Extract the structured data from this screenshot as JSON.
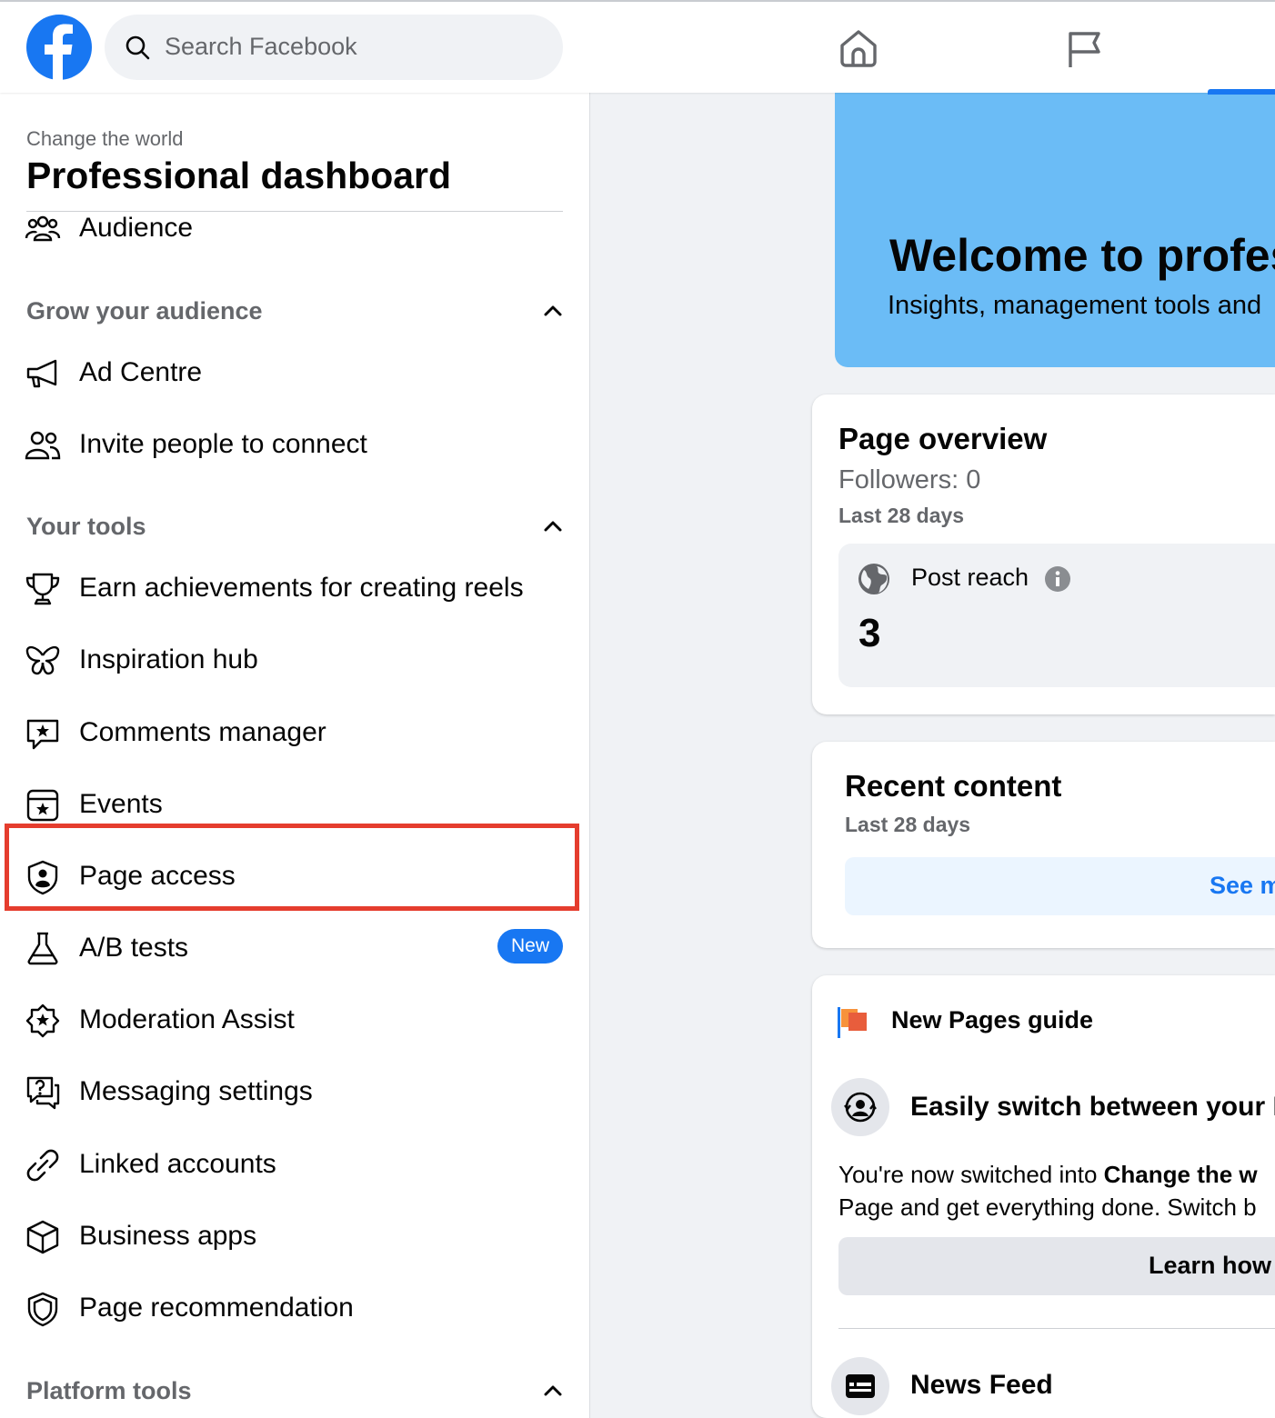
{
  "topbar": {
    "search_placeholder": "Search Facebook",
    "logo": "facebook-logo-icon",
    "nav_icons": [
      "home-icon",
      "flag-icon"
    ]
  },
  "sidebar": {
    "subtitle": "Change the world",
    "title": "Professional dashboard",
    "top_item": {
      "label": "Audience",
      "icon": "audience-icon"
    },
    "sections": [
      {
        "label": "Grow your audience",
        "items": [
          {
            "label": "Ad Centre",
            "icon": "megaphone-icon"
          },
          {
            "label": "Invite people to connect",
            "icon": "people-icon"
          }
        ]
      },
      {
        "label": "Your tools",
        "items": [
          {
            "label": "Earn achievements for creating reels",
            "icon": "trophy-icon"
          },
          {
            "label": "Inspiration hub",
            "icon": "butterfly-icon"
          },
          {
            "label": "Comments manager",
            "icon": "comment-star-icon"
          },
          {
            "label": "Events",
            "icon": "calendar-star-icon"
          },
          {
            "label": "Page access",
            "icon": "shield-person-icon"
          },
          {
            "label": "A/B tests",
            "icon": "flask-icon",
            "badge": "New"
          },
          {
            "label": "Moderation Assist",
            "icon": "gear-star-icon"
          },
          {
            "label": "Messaging settings",
            "icon": "message-question-icon"
          },
          {
            "label": "Linked accounts",
            "icon": "link-icon"
          },
          {
            "label": "Business apps",
            "icon": "cube-icon"
          },
          {
            "label": "Page recommendation",
            "icon": "shield-icon"
          }
        ]
      },
      {
        "label": "Platform tools",
        "items": []
      }
    ]
  },
  "main": {
    "banner": {
      "title": "Welcome to profes",
      "subtitle": "Insights, management tools and"
    },
    "overview": {
      "title": "Page overview",
      "followers": "Followers: 0",
      "period": "Last 28 days",
      "metric_label": "Post reach",
      "metric_value": "3"
    },
    "recent": {
      "title": "Recent content",
      "period": "Last 28 days",
      "button": "See m"
    },
    "guide": {
      "title": "New Pages guide",
      "item_title": "Easily switch between your P",
      "text_line1_pre": "You're now switched into ",
      "text_line1_bold": "Change the w",
      "text_line2": "Page and get everything done. Switch b",
      "button": "Learn how",
      "next_item": "News Feed"
    }
  },
  "colors": {
    "accent": "#1877f2",
    "banner": "#6bbcf6",
    "highlight": "#e53d2e"
  }
}
